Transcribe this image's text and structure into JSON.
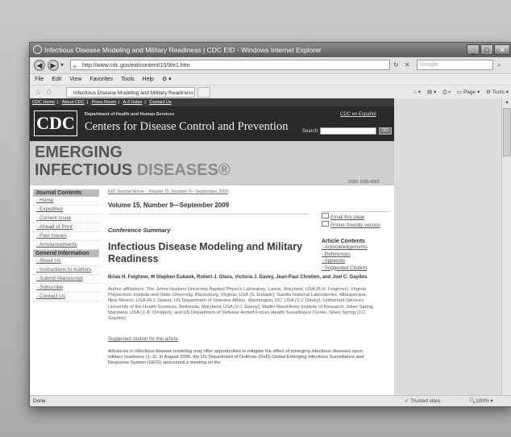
{
  "window": {
    "title": "Infectious Disease Modeling and Military Readiness | CDC EID - Windows Internet Explorer",
    "min": "_",
    "max": "□",
    "close": "✕"
  },
  "address": {
    "url": "http://www.cdc.gov/eid/content/15/9/e1.htm",
    "search_placeholder": "Google",
    "go_label": "✕",
    "refresh_label": "↻"
  },
  "menu": [
    "File",
    "Edit",
    "View",
    "Favorites",
    "Tools",
    "Help"
  ],
  "tab": {
    "label": "Infectious Disease Modeling and Military Readiness | ..."
  },
  "command_bar": {
    "page": "Page",
    "tools": "Tools"
  },
  "page": {
    "top_links": [
      "CDC Home",
      "About CDC",
      "Press Room",
      "A-Z Index",
      "Contact Us"
    ],
    "cdc_logo": "CDC",
    "dept": "Department of Health and Human Services",
    "centers": "Centers for Disease Control and Prevention",
    "espanol": "CDC en Español",
    "search_label": "Search:",
    "search_go": "GO",
    "eid_line1": "EMERGING",
    "eid_line2a": "INFECTIOUS",
    "eid_line2b": "DISEASES®",
    "issn": "ISSN: 1080-6059"
  },
  "sidebar": {
    "journal_head": "Journal Contents",
    "journal_items": [
      "Home",
      "Expedited",
      "Current Issue",
      "Ahead of Print",
      "Past Issues",
      "Announcements"
    ],
    "general_head": "General Information",
    "general_items": [
      "About Us",
      "Instructions to Authors",
      "Submit Manuscript",
      "Subscribe",
      "Contact Us"
    ]
  },
  "article": {
    "breadcrumb": "EID Journal Home › Volume 15, Number 9—September 2009",
    "volume": "Volume 15, Number 9—September 2009",
    "section": "Conference Summary",
    "title": "Infectious Disease Modeling and Military Readiness",
    "authors": "Brian H. Feighner, ✉ Stephen Eubank, Robert J. Glass, Victoria J. Davey, Jean-Paul Chretien, and Joel C. Gaydos",
    "affiliations": "Author affiliations: The Johns Hopkins University Applied Physics Laboratory, Laurel, Maryland, USA (B.H. Feighner); Virginia Polytechnic Institute and State University, Blacksburg, Virginia, USA (S. Eubank); Sandia National Laboratories, Albuquerque, New Mexico, USA (R.J. Glass); US Department of Veterans Affairs, Washington, DC, USA (V.J. Davey); Uniformed Services University of the Health Sciences, Bethesda, Maryland, USA (V.J. Davey); Walter Reed Army Institute of Research, Silver Spring, Maryland, USA (J.-P. Chretien); and US Department of Defense Armed Forces Health Surveillance Center, Silver Spring (J.C. Gaydos)",
    "suggested": "Suggested citation for this article",
    "abstract": "Advances in infectious disease modeling may offer opportunities to mitigate the effect of emerging infectious diseases upon military readiness (1–3). In August 2005, the US Department of Defense (DoD) Global Emerging Infections Surveillance and Response System (GEIS) sponsored a meeting on the"
  },
  "tools": {
    "email": "Email this page",
    "printer": "Printer-friendly version",
    "contents_head": "Article Contents",
    "contents": [
      "Acknowledgements",
      "References",
      "Appendix",
      "Suggested Citation"
    ]
  },
  "status": {
    "left": "Done",
    "zone": "Trusted sites",
    "zoom": "100%"
  }
}
